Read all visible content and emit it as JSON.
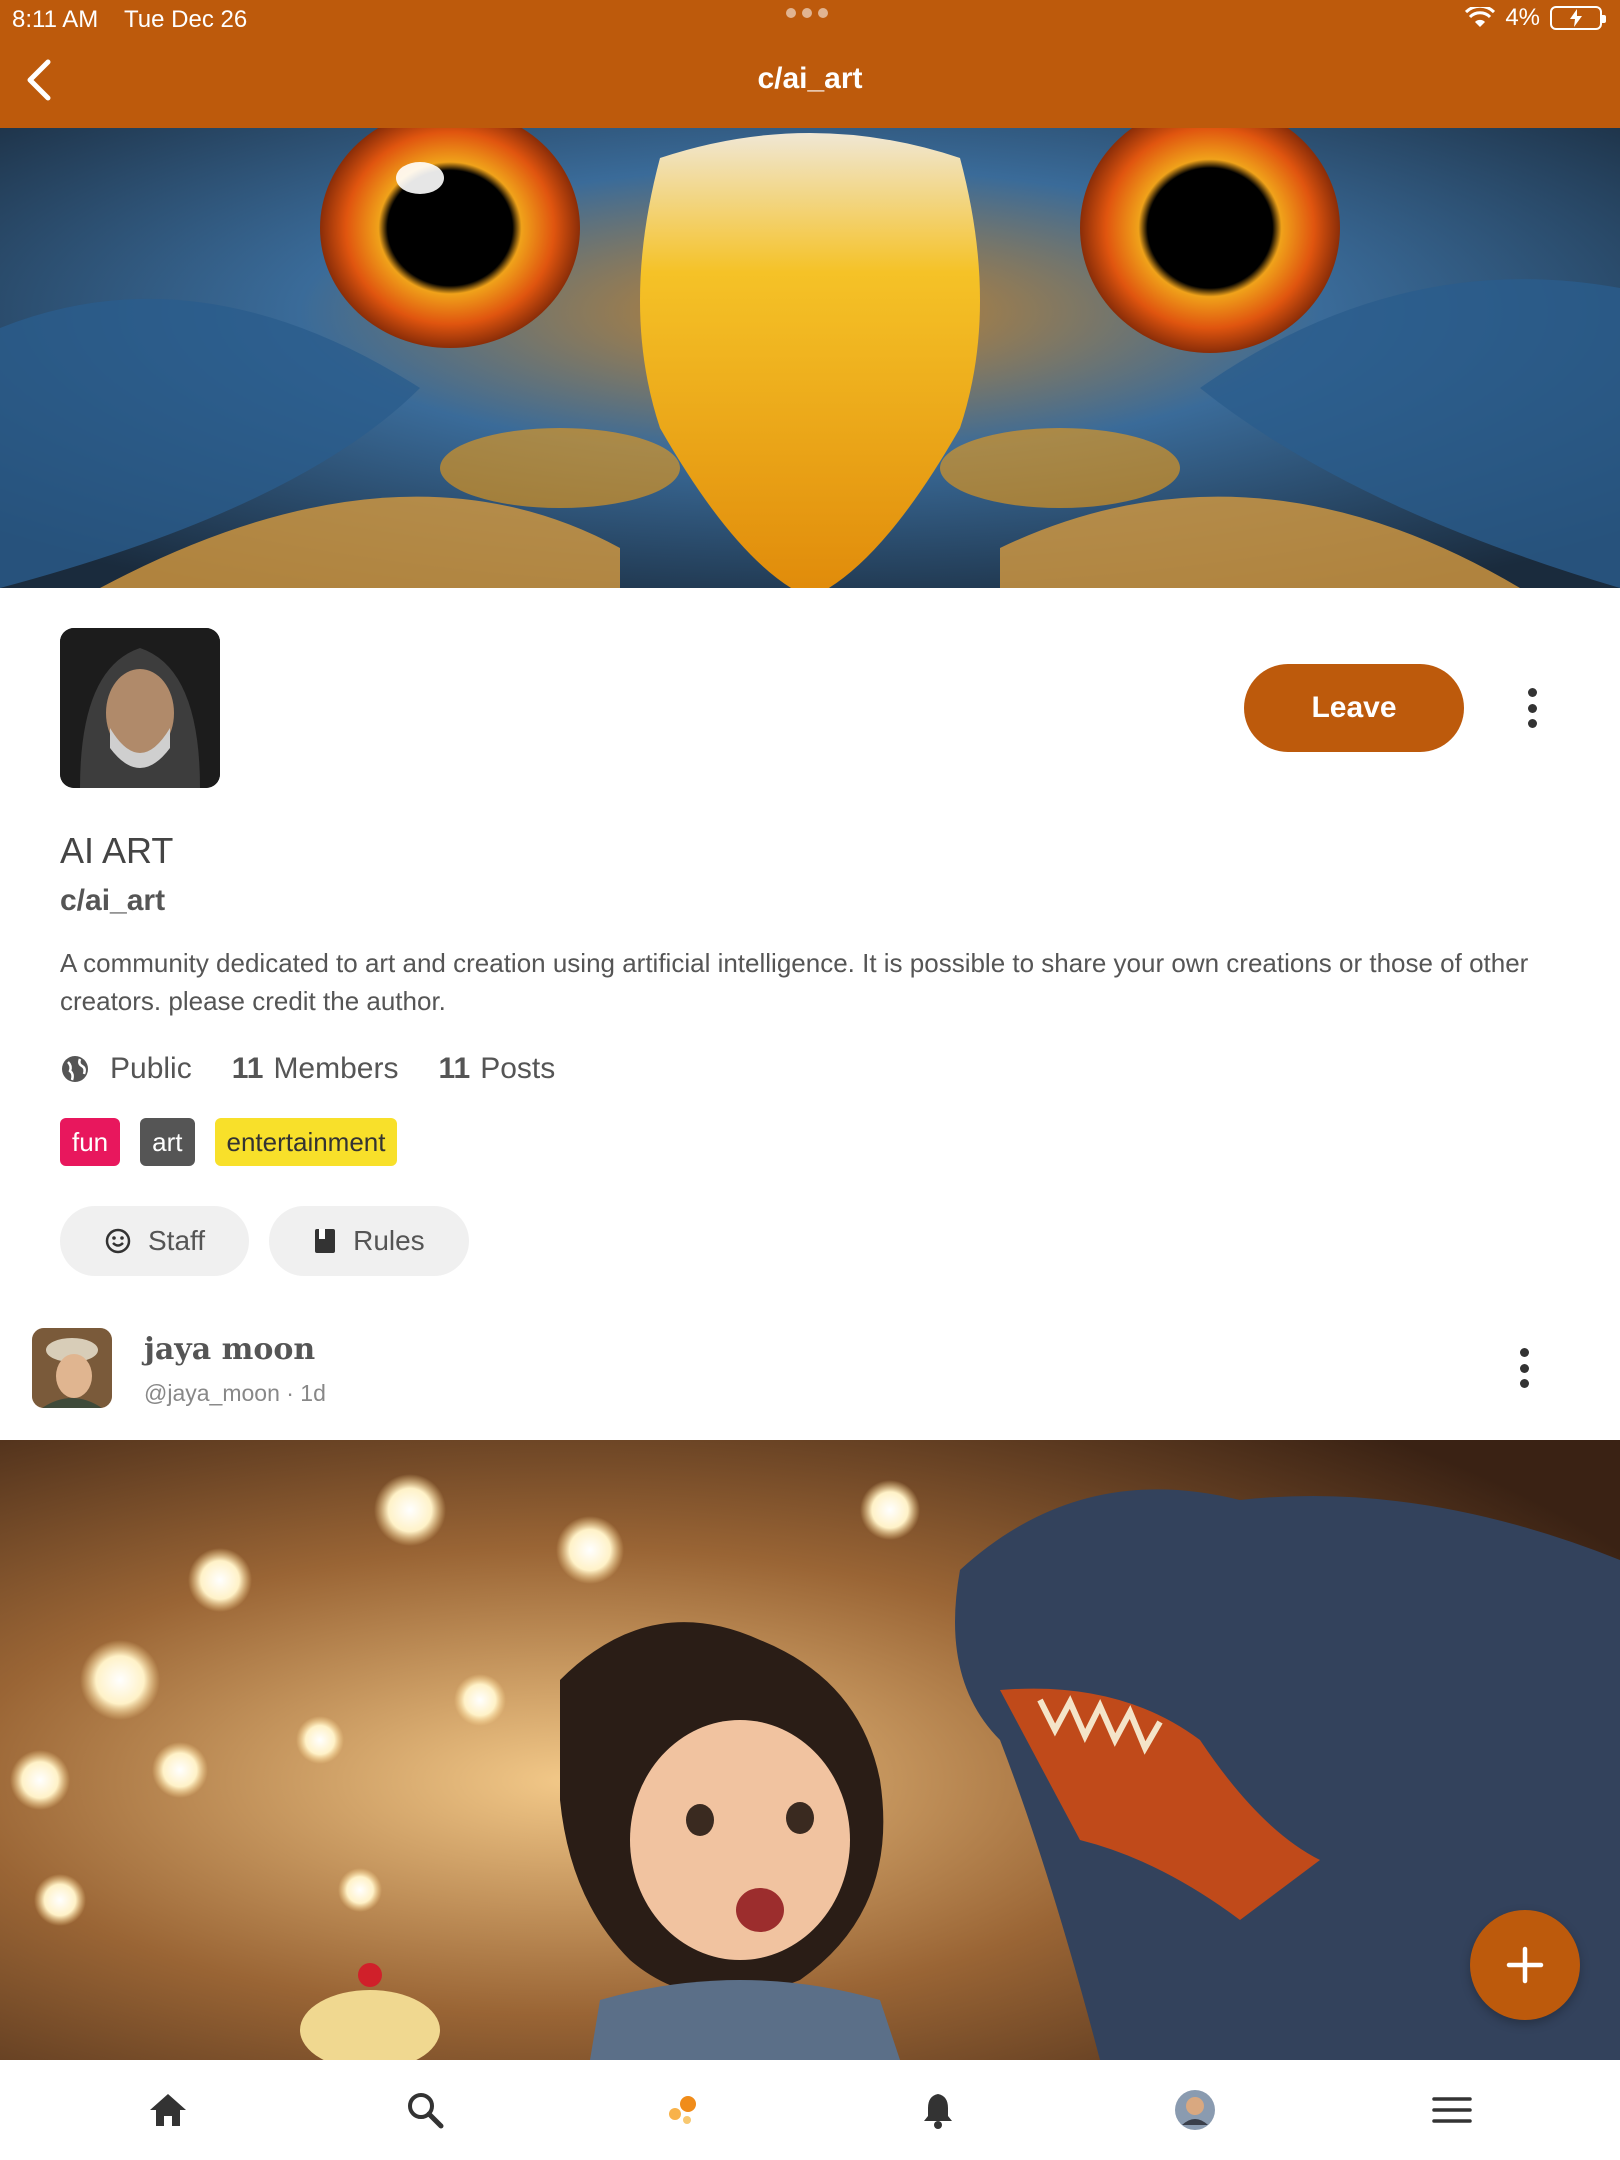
{
  "status_bar": {
    "time": "8:11 AM",
    "date": "Tue Dec 26",
    "battery": "4%"
  },
  "nav": {
    "title": "c/ai_art"
  },
  "community": {
    "name": "AI ART",
    "handle": "c/ai_art",
    "description": "A community dedicated to art and creation using artificial intelligence. It is possible to share your own creations or those of other creators.  please credit the author.",
    "visibility": "Public",
    "members_count": "11",
    "members_label": "Members",
    "posts_count": "11",
    "posts_label": "Posts",
    "leave_label": "Leave",
    "tags": [
      {
        "label": "fun",
        "bg": "#e8175d",
        "fg": "#ffffff"
      },
      {
        "label": "art",
        "bg": "#555555",
        "fg": "#ffffff"
      },
      {
        "label": "entertainment",
        "bg": "#f8e02a",
        "fg": "#333333"
      }
    ],
    "staff_label": "Staff",
    "rules_label": "Rules"
  },
  "post": {
    "author": "jaya moon",
    "meta": "@jaya_moon · 1d"
  },
  "colors": {
    "accent": "#bd5a0c"
  },
  "bottom_nav": [
    "home-icon",
    "search-icon",
    "communities-icon",
    "bell-icon",
    "profile-avatar",
    "menu-icon"
  ]
}
